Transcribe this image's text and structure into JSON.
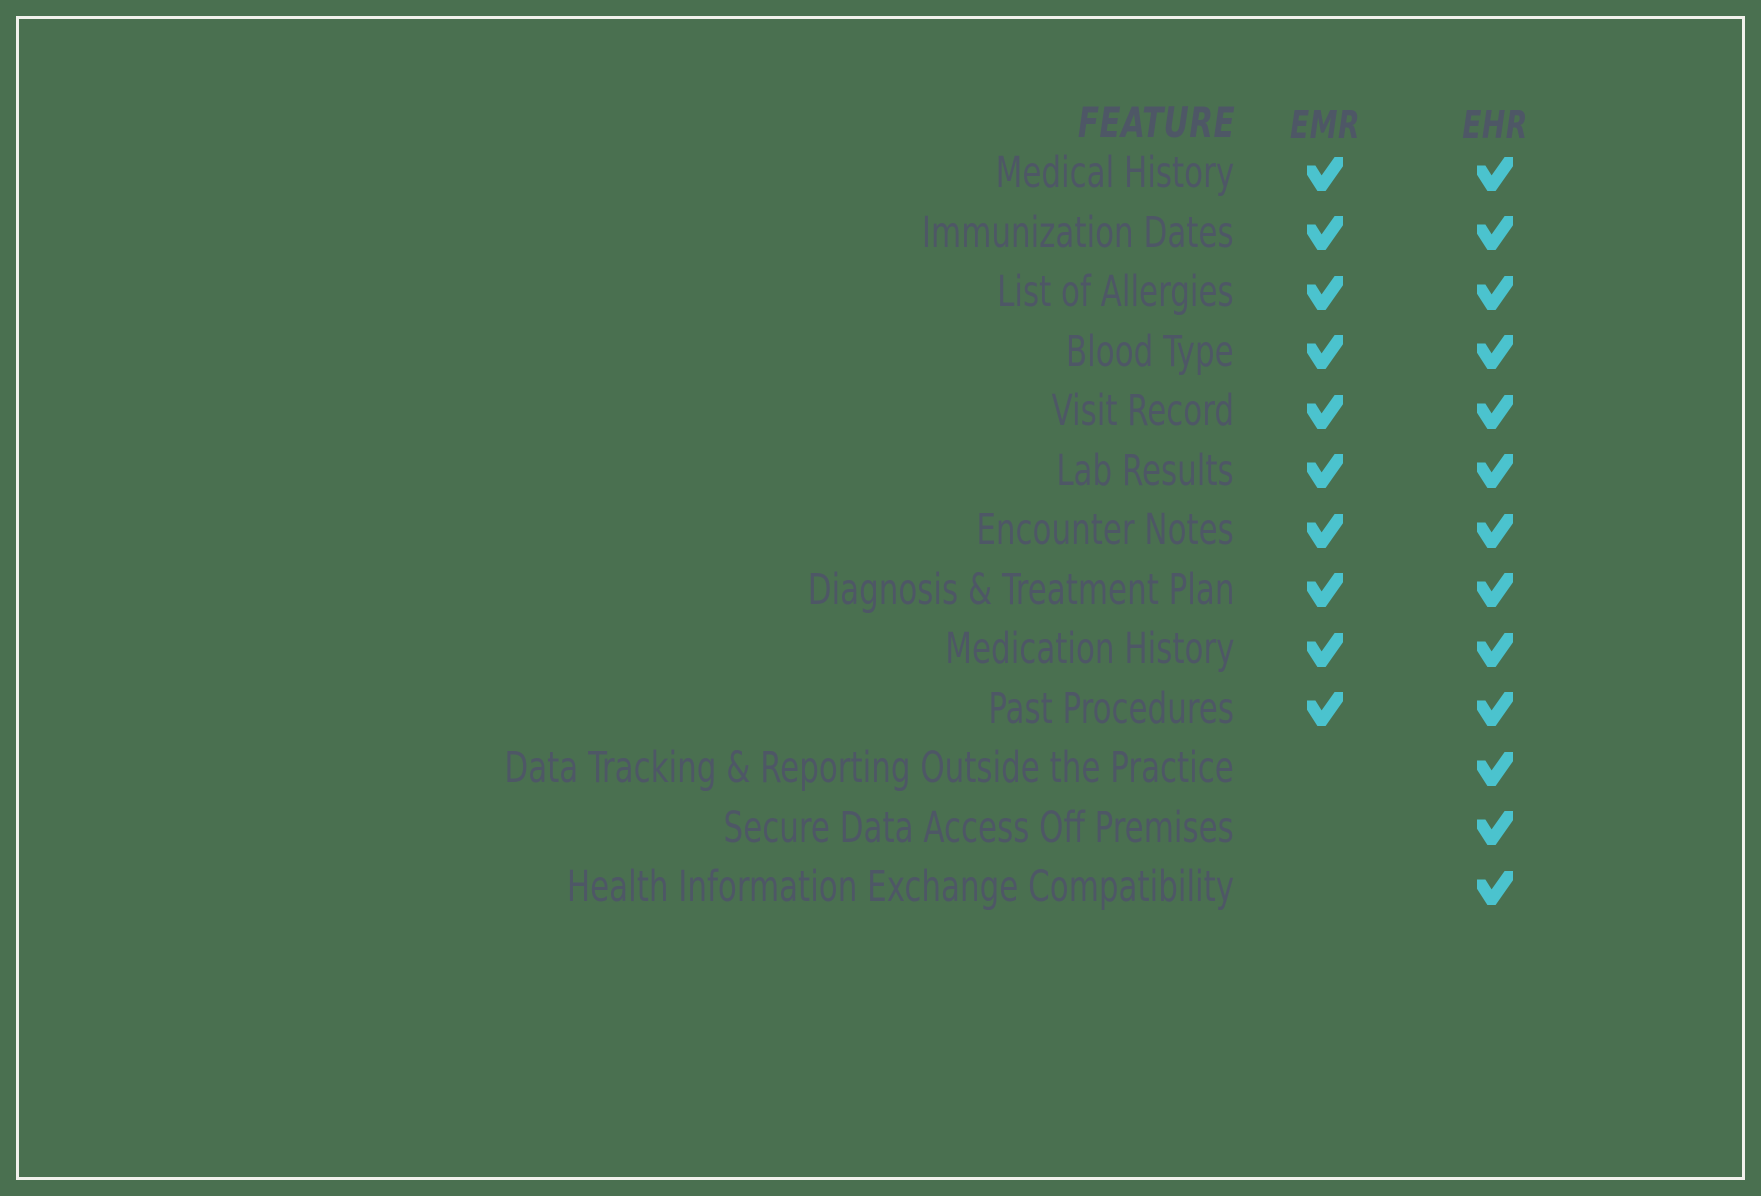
{
  "theme": {
    "background_color": "#4a7050",
    "border_color": "#f1f1ec",
    "text_color": "#4e5766",
    "check_color": "#4bc3ce"
  },
  "table": {
    "headers": {
      "feature": "FEATURE",
      "emr": "EMR",
      "ehr": "EHR"
    },
    "check_icon_name": "check-icon",
    "rows": [
      {
        "feature": "Medical History",
        "emr": true,
        "ehr": true
      },
      {
        "feature": "Immunization Dates",
        "emr": true,
        "ehr": true
      },
      {
        "feature": "List of Allergies",
        "emr": true,
        "ehr": true
      },
      {
        "feature": "Blood Type",
        "emr": true,
        "ehr": true
      },
      {
        "feature": "Visit Record",
        "emr": true,
        "ehr": true
      },
      {
        "feature": "Lab Results",
        "emr": true,
        "ehr": true
      },
      {
        "feature": "Encounter Notes",
        "emr": true,
        "ehr": true
      },
      {
        "feature": "Diagnosis & Treatment Plan",
        "emr": true,
        "ehr": true
      },
      {
        "feature": "Medication History",
        "emr": true,
        "ehr": true
      },
      {
        "feature": "Past Procedures",
        "emr": true,
        "ehr": true
      },
      {
        "feature": "Data Tracking & Reporting Outside the Practice",
        "emr": false,
        "ehr": true
      },
      {
        "feature": "Secure Data Access Off Premises",
        "emr": false,
        "ehr": true
      },
      {
        "feature": "Health Information Exchange Compatibility",
        "emr": false,
        "ehr": true
      }
    ]
  }
}
